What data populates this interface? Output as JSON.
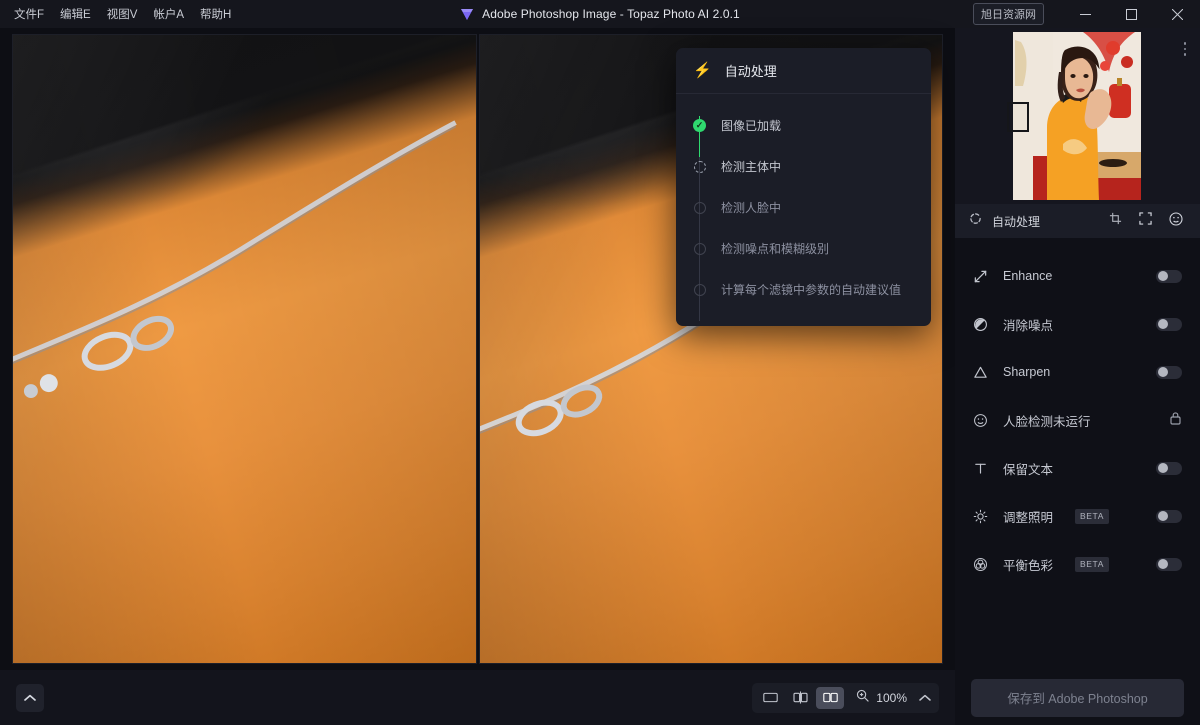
{
  "titlebar": {
    "menu": [
      {
        "label": "文件F",
        "name": "menu-file"
      },
      {
        "label": "编辑E",
        "name": "menu-edit"
      },
      {
        "label": "视图V",
        "name": "menu-view"
      },
      {
        "label": "帐户A",
        "name": "menu-account"
      },
      {
        "label": "帮助H",
        "name": "menu-help"
      }
    ],
    "app_title": "Adobe Photoshop Image - Topaz Photo AI 2.0.1",
    "app_icon": "gem-icon",
    "watermark_button": "旭日资源网",
    "minimize": "—",
    "maximize": "▢",
    "close": "✕"
  },
  "auto_popup": {
    "icon": "lightning-bolt-icon",
    "title": "自动处理",
    "steps": [
      {
        "label": "图像已加载",
        "state": "done"
      },
      {
        "label": "检测主体中",
        "state": "running"
      },
      {
        "label": "检测人脸中",
        "state": "pending"
      },
      {
        "label": "检测噪点和模糊级别",
        "state": "pending"
      },
      {
        "label": "计算每个滤镜中参数的自动建议值",
        "state": "pending"
      }
    ]
  },
  "right_panel": {
    "navigator": {
      "kebab": "more-options-icon"
    },
    "autoprocess": {
      "label": "自动处理",
      "icons": [
        "crop-icon",
        "fit-screen-icon",
        "face-icon"
      ]
    },
    "filters": [
      {
        "name": "enhance",
        "icon": "enhance-icon",
        "label": "Enhance",
        "control": "toggle",
        "enabled": false
      },
      {
        "name": "remove-noise",
        "icon": "denoise-icon",
        "label": "消除噪点",
        "control": "toggle",
        "enabled": false
      },
      {
        "name": "sharpen",
        "icon": "sharpen-icon",
        "label": "Sharpen",
        "control": "toggle",
        "enabled": false
      },
      {
        "name": "face-recovery",
        "icon": "face-icon",
        "label": "人脸检测未运行",
        "control": "lock",
        "enabled": false
      },
      {
        "name": "preserve-text",
        "icon": "text-icon",
        "label": "保留文本",
        "control": "toggle",
        "enabled": false
      },
      {
        "name": "adjust-lighting",
        "icon": "sun-icon",
        "label": "调整照明",
        "badge": "BETA",
        "control": "toggle",
        "enabled": false
      },
      {
        "name": "balance-color",
        "icon": "color-balance-icon",
        "label": "平衡色彩",
        "badge": "BETA",
        "control": "toggle",
        "enabled": false
      }
    ]
  },
  "bottombar": {
    "collapse_icon": "chevron-up-icon",
    "view_modes": [
      {
        "name": "single-view",
        "icon": "single-pane-icon",
        "active": false
      },
      {
        "name": "split-view",
        "icon": "split-pane-icon",
        "active": false
      },
      {
        "name": "side-by-side-view",
        "icon": "side-by-side-icon",
        "active": true
      }
    ],
    "zoom_icon": "magnifier-icon",
    "zoom_level": "100%",
    "zoom_caret": "chevron-up-icon"
  },
  "save": {
    "label": "保存到 Adobe Photoshop",
    "enabled": false
  },
  "colors": {
    "accent_green": "#2fd96f",
    "titlebar_bg": "#15161d",
    "panel_bg": "#0f1017",
    "popup_bg": "#1b1d27",
    "active_view": "#4a4d5b"
  }
}
